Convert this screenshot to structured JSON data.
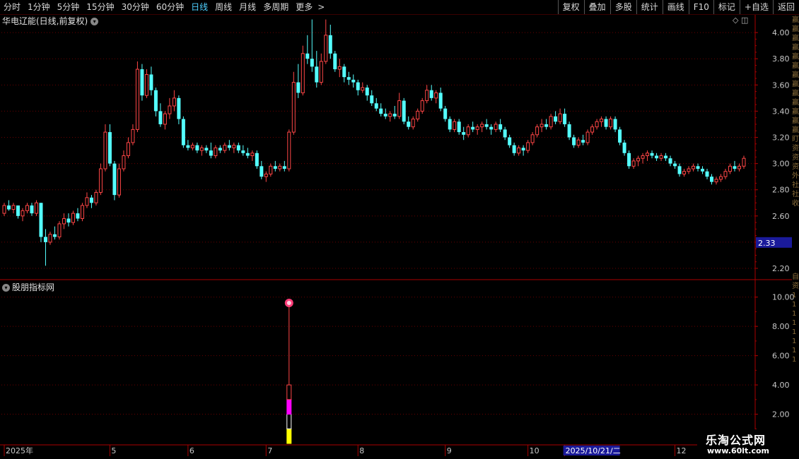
{
  "toolbar": {
    "periods": [
      {
        "label": "分时",
        "active": false
      },
      {
        "label": "1分钟",
        "active": false
      },
      {
        "label": "5分钟",
        "active": false
      },
      {
        "label": "15分钟",
        "active": false
      },
      {
        "label": "30分钟",
        "active": false
      },
      {
        "label": "60分钟",
        "active": false
      },
      {
        "label": "日线",
        "active": true
      },
      {
        "label": "周线",
        "active": false
      },
      {
        "label": "月线",
        "active": false
      },
      {
        "label": "多周期",
        "active": false
      },
      {
        "label": "更多",
        "active": false
      }
    ],
    "more_arrow": ">",
    "actions": [
      "复权",
      "叠加",
      "多股",
      "统计",
      "画线",
      "F10",
      "标记",
      "+自选",
      "返回"
    ]
  },
  "stock_title": "华电辽能(日线,前复权)",
  "indicator_title": "股朋指标网",
  "right_strip_chars": [
    "赢",
    "赢",
    "赢",
    "赢",
    "赢",
    "赢",
    "赢",
    "赢",
    "赢",
    "赢",
    "赢",
    "赢",
    "赢",
    "盯",
    "资",
    "资",
    "资",
    "外",
    "社",
    "社",
    "收",
    "",
    "",
    "",
    "",
    "",
    "",
    "",
    "自",
    "资",
    "1",
    "1",
    "1",
    "1",
    "1",
    "1",
    "1",
    "1"
  ],
  "watermark": {
    "main": "乐淘公式网",
    "sub": "www.60lt.com"
  },
  "colors": {
    "up": "#ff4646",
    "down": "#54ffff",
    "grid": "#6a0000",
    "axis": "#aa0000",
    "price_marker_bg": "#1a1a9a",
    "magenta": "#ff00ff",
    "yellow": "#ffff00"
  },
  "chart_data": [
    {
      "type": "candlestick",
      "title": "华电辽能(日线,前复权)",
      "y_ticks": [
        2.2,
        2.4,
        2.6,
        2.8,
        3.0,
        3.2,
        3.4,
        3.6,
        3.8,
        4.0
      ],
      "y_tick_labels": [
        "2.20",
        "2.40",
        "2.60",
        "2.80",
        "3.00",
        "3.20",
        "3.40",
        "3.60",
        "3.80",
        "4.00"
      ],
      "ylim": [
        2.13,
        4.13
      ],
      "price_marker": "2.33",
      "x_labels": [
        {
          "label": "2025年",
          "index": 0
        },
        {
          "label": "5",
          "index": 23
        },
        {
          "label": "6",
          "index": 40
        },
        {
          "label": "7",
          "index": 57
        },
        {
          "label": "8",
          "index": 77
        },
        {
          "label": "9",
          "index": 96
        },
        {
          "label": "10",
          "index": 114
        },
        {
          "label": "2025/10/21/二",
          "index": 122,
          "highlight": true
        },
        {
          "label": "12",
          "index": 146
        }
      ],
      "ohlc": [
        [
          2.62,
          2.7,
          2.6,
          2.68
        ],
        [
          2.68,
          2.72,
          2.64,
          2.65
        ],
        [
          2.65,
          2.7,
          2.62,
          2.68
        ],
        [
          2.68,
          2.68,
          2.58,
          2.6
        ],
        [
          2.6,
          2.66,
          2.56,
          2.64
        ],
        [
          2.64,
          2.7,
          2.62,
          2.68
        ],
        [
          2.68,
          2.7,
          2.6,
          2.62
        ],
        [
          2.62,
          2.72,
          2.6,
          2.7
        ],
        [
          2.7,
          2.7,
          2.4,
          2.44
        ],
        [
          2.44,
          2.5,
          2.22,
          2.4
        ],
        [
          2.4,
          2.48,
          2.38,
          2.46
        ],
        [
          2.46,
          2.52,
          2.42,
          2.44
        ],
        [
          2.44,
          2.56,
          2.42,
          2.54
        ],
        [
          2.54,
          2.62,
          2.5,
          2.58
        ],
        [
          2.58,
          2.62,
          2.52,
          2.55
        ],
        [
          2.55,
          2.64,
          2.53,
          2.62
        ],
        [
          2.62,
          2.66,
          2.56,
          2.58
        ],
        [
          2.58,
          2.7,
          2.56,
          2.68
        ],
        [
          2.68,
          2.78,
          2.66,
          2.74
        ],
        [
          2.74,
          2.76,
          2.66,
          2.7
        ],
        [
          2.7,
          2.8,
          2.68,
          2.78
        ],
        [
          2.78,
          3.0,
          2.76,
          2.96
        ],
        [
          2.96,
          3.3,
          2.94,
          3.24
        ],
        [
          3.24,
          3.3,
          2.98,
          3.0
        ],
        [
          3.0,
          3.02,
          2.72,
          2.76
        ],
        [
          2.76,
          3.0,
          2.74,
          2.96
        ],
        [
          2.96,
          3.1,
          2.94,
          3.06
        ],
        [
          3.06,
          3.2,
          3.04,
          3.16
        ],
        [
          3.16,
          3.3,
          3.14,
          3.26
        ],
        [
          3.26,
          3.78,
          3.24,
          3.72
        ],
        [
          3.72,
          3.76,
          3.48,
          3.52
        ],
        [
          3.52,
          3.72,
          3.5,
          3.68
        ],
        [
          3.68,
          3.74,
          3.52,
          3.56
        ],
        [
          3.56,
          3.58,
          3.36,
          3.4
        ],
        [
          3.4,
          3.46,
          3.28,
          3.3
        ],
        [
          3.3,
          3.4,
          3.26,
          3.38
        ],
        [
          3.38,
          3.5,
          3.34,
          3.44
        ],
        [
          3.44,
          3.56,
          3.4,
          3.5
        ],
        [
          3.5,
          3.52,
          3.3,
          3.34
        ],
        [
          3.34,
          3.36,
          3.12,
          3.14
        ],
        [
          3.14,
          3.18,
          3.1,
          3.12
        ],
        [
          3.12,
          3.16,
          3.1,
          3.14
        ],
        [
          3.14,
          3.16,
          3.08,
          3.1
        ],
        [
          3.1,
          3.14,
          3.06,
          3.12
        ],
        [
          3.12,
          3.14,
          3.08,
          3.1
        ],
        [
          3.1,
          3.16,
          3.04,
          3.06
        ],
        [
          3.06,
          3.14,
          3.04,
          3.12
        ],
        [
          3.12,
          3.14,
          3.08,
          3.1
        ],
        [
          3.1,
          3.16,
          3.08,
          3.14
        ],
        [
          3.14,
          3.18,
          3.1,
          3.12
        ],
        [
          3.12,
          3.16,
          3.08,
          3.14
        ],
        [
          3.14,
          3.16,
          3.08,
          3.1
        ],
        [
          3.1,
          3.14,
          3.06,
          3.08
        ],
        [
          3.08,
          3.12,
          3.04,
          3.06
        ],
        [
          3.06,
          3.1,
          3.02,
          3.08
        ],
        [
          3.08,
          3.1,
          2.96,
          2.98
        ],
        [
          2.98,
          3.02,
          2.88,
          2.9
        ],
        [
          2.9,
          2.94,
          2.86,
          2.92
        ],
        [
          2.92,
          3.0,
          2.9,
          2.98
        ],
        [
          2.98,
          3.02,
          2.94,
          2.96
        ],
        [
          2.96,
          3.0,
          2.94,
          2.98
        ],
        [
          2.98,
          3.02,
          2.94,
          2.96
        ],
        [
          2.96,
          3.26,
          2.94,
          3.24
        ],
        [
          3.24,
          3.7,
          3.22,
          3.62
        ],
        [
          3.62,
          3.76,
          3.5,
          3.54
        ],
        [
          3.54,
          3.9,
          3.52,
          3.84
        ],
        [
          3.84,
          3.98,
          3.76,
          3.8
        ],
        [
          3.8,
          4.1,
          3.7,
          3.74
        ],
        [
          3.74,
          3.86,
          3.58,
          3.62
        ],
        [
          3.62,
          3.84,
          3.6,
          3.78
        ],
        [
          3.78,
          4.1,
          3.76,
          3.98
        ],
        [
          3.98,
          4.06,
          3.8,
          3.84
        ],
        [
          3.84,
          3.86,
          3.7,
          3.72
        ],
        [
          3.72,
          3.8,
          3.66,
          3.74
        ],
        [
          3.74,
          3.76,
          3.62,
          3.66
        ],
        [
          3.66,
          3.7,
          3.6,
          3.64
        ],
        [
          3.64,
          3.68,
          3.58,
          3.62
        ],
        [
          3.62,
          3.64,
          3.52,
          3.56
        ],
        [
          3.56,
          3.62,
          3.54,
          3.58
        ],
        [
          3.58,
          3.6,
          3.48,
          3.52
        ],
        [
          3.52,
          3.56,
          3.44,
          3.46
        ],
        [
          3.46,
          3.5,
          3.4,
          3.42
        ],
        [
          3.42,
          3.46,
          3.36,
          3.38
        ],
        [
          3.38,
          3.42,
          3.34,
          3.36
        ],
        [
          3.36,
          3.4,
          3.32,
          3.38
        ],
        [
          3.38,
          3.44,
          3.34,
          3.36
        ],
        [
          3.36,
          3.54,
          3.34,
          3.48
        ],
        [
          3.48,
          3.5,
          3.3,
          3.32
        ],
        [
          3.32,
          3.36,
          3.26,
          3.28
        ],
        [
          3.28,
          3.36,
          3.26,
          3.34
        ],
        [
          3.34,
          3.42,
          3.32,
          3.4
        ],
        [
          3.4,
          3.5,
          3.38,
          3.48
        ],
        [
          3.48,
          3.6,
          3.46,
          3.56
        ],
        [
          3.56,
          3.6,
          3.48,
          3.5
        ],
        [
          3.5,
          3.56,
          3.46,
          3.54
        ],
        [
          3.54,
          3.58,
          3.4,
          3.42
        ],
        [
          3.42,
          3.44,
          3.32,
          3.34
        ],
        [
          3.34,
          3.36,
          3.24,
          3.26
        ],
        [
          3.26,
          3.34,
          3.24,
          3.32
        ],
        [
          3.32,
          3.34,
          3.22,
          3.24
        ],
        [
          3.24,
          3.28,
          3.18,
          3.22
        ],
        [
          3.22,
          3.3,
          3.2,
          3.28
        ],
        [
          3.28,
          3.32,
          3.24,
          3.26
        ],
        [
          3.26,
          3.3,
          3.22,
          3.28
        ],
        [
          3.28,
          3.32,
          3.24,
          3.3
        ],
        [
          3.3,
          3.34,
          3.26,
          3.28
        ],
        [
          3.28,
          3.3,
          3.22,
          3.26
        ],
        [
          3.26,
          3.32,
          3.24,
          3.3
        ],
        [
          3.3,
          3.34,
          3.24,
          3.26
        ],
        [
          3.26,
          3.28,
          3.18,
          3.2
        ],
        [
          3.2,
          3.22,
          3.12,
          3.14
        ],
        [
          3.14,
          3.16,
          3.06,
          3.08
        ],
        [
          3.08,
          3.14,
          3.06,
          3.12
        ],
        [
          3.12,
          3.14,
          3.06,
          3.1
        ],
        [
          3.1,
          3.18,
          3.08,
          3.16
        ],
        [
          3.16,
          3.24,
          3.14,
          3.22
        ],
        [
          3.22,
          3.3,
          3.2,
          3.28
        ],
        [
          3.28,
          3.34,
          3.24,
          3.3
        ],
        [
          3.3,
          3.34,
          3.26,
          3.28
        ],
        [
          3.28,
          3.38,
          3.26,
          3.36
        ],
        [
          3.36,
          3.4,
          3.3,
          3.32
        ],
        [
          3.32,
          3.42,
          3.3,
          3.38
        ],
        [
          3.38,
          3.42,
          3.28,
          3.3
        ],
        [
          3.3,
          3.32,
          3.18,
          3.2
        ],
        [
          3.2,
          3.22,
          3.12,
          3.14
        ],
        [
          3.14,
          3.2,
          3.12,
          3.18
        ],
        [
          3.18,
          3.22,
          3.14,
          3.16
        ],
        [
          3.16,
          3.26,
          3.14,
          3.24
        ],
        [
          3.24,
          3.3,
          3.22,
          3.28
        ],
        [
          3.28,
          3.34,
          3.26,
          3.32
        ],
        [
          3.32,
          3.36,
          3.28,
          3.34
        ],
        [
          3.34,
          3.36,
          3.26,
          3.28
        ],
        [
          3.28,
          3.36,
          3.26,
          3.34
        ],
        [
          3.34,
          3.36,
          3.24,
          3.26
        ],
        [
          3.26,
          3.28,
          3.14,
          3.16
        ],
        [
          3.16,
          3.18,
          3.06,
          3.08
        ],
        [
          3.08,
          3.1,
          2.96,
          2.98
        ],
        [
          2.98,
          3.04,
          2.96,
          3.02
        ],
        [
          3.02,
          3.06,
          2.98,
          3.04
        ],
        [
          3.04,
          3.08,
          3.0,
          3.06
        ],
        [
          3.06,
          3.1,
          3.02,
          3.08
        ],
        [
          3.08,
          3.1,
          3.04,
          3.06
        ],
        [
          3.06,
          3.08,
          3.02,
          3.04
        ],
        [
          3.04,
          3.08,
          3.02,
          3.06
        ],
        [
          3.06,
          3.08,
          3.02,
          3.04
        ],
        [
          3.04,
          3.06,
          2.98,
          3.0
        ],
        [
          3.0,
          3.02,
          2.96,
          2.98
        ],
        [
          2.98,
          3.0,
          2.9,
          2.92
        ],
        [
          2.92,
          2.96,
          2.9,
          2.94
        ],
        [
          2.94,
          2.98,
          2.92,
          2.96
        ],
        [
          2.96,
          3.0,
          2.94,
          2.98
        ],
        [
          2.98,
          3.0,
          2.94,
          2.96
        ],
        [
          2.96,
          2.98,
          2.92,
          2.94
        ],
        [
          2.94,
          2.96,
          2.88,
          2.9
        ],
        [
          2.9,
          2.92,
          2.84,
          2.86
        ],
        [
          2.86,
          2.9,
          2.84,
          2.88
        ],
        [
          2.88,
          2.92,
          2.86,
          2.9
        ],
        [
          2.9,
          2.96,
          2.88,
          2.94
        ],
        [
          2.94,
          3.0,
          2.92,
          2.98
        ],
        [
          2.98,
          3.02,
          2.94,
          2.96
        ],
        [
          2.96,
          3.0,
          2.94,
          2.98
        ],
        [
          2.98,
          3.06,
          2.96,
          3.04
        ]
      ]
    },
    {
      "type": "bar",
      "title": "股朋指标网",
      "y_ticks": [
        2,
        4,
        6,
        8,
        10
      ],
      "y_tick_labels": [
        "2.00",
        "4.00",
        "6.00",
        "8.00",
        "10.00"
      ],
      "ylim": [
        0,
        11
      ],
      "signal_index": 62,
      "signal_value": 9.6,
      "stack": [
        {
          "from": 0,
          "to": 1.0,
          "color": "#ffff00",
          "fill": true
        },
        {
          "from": 1.0,
          "to": 2.0,
          "color": "#ffffff",
          "fill": false
        },
        {
          "from": 2.0,
          "to": 3.0,
          "color": "#ff00ff",
          "fill": true
        },
        {
          "from": 3.0,
          "to": 4.0,
          "color": "#ff4646",
          "fill": false
        }
      ]
    }
  ]
}
